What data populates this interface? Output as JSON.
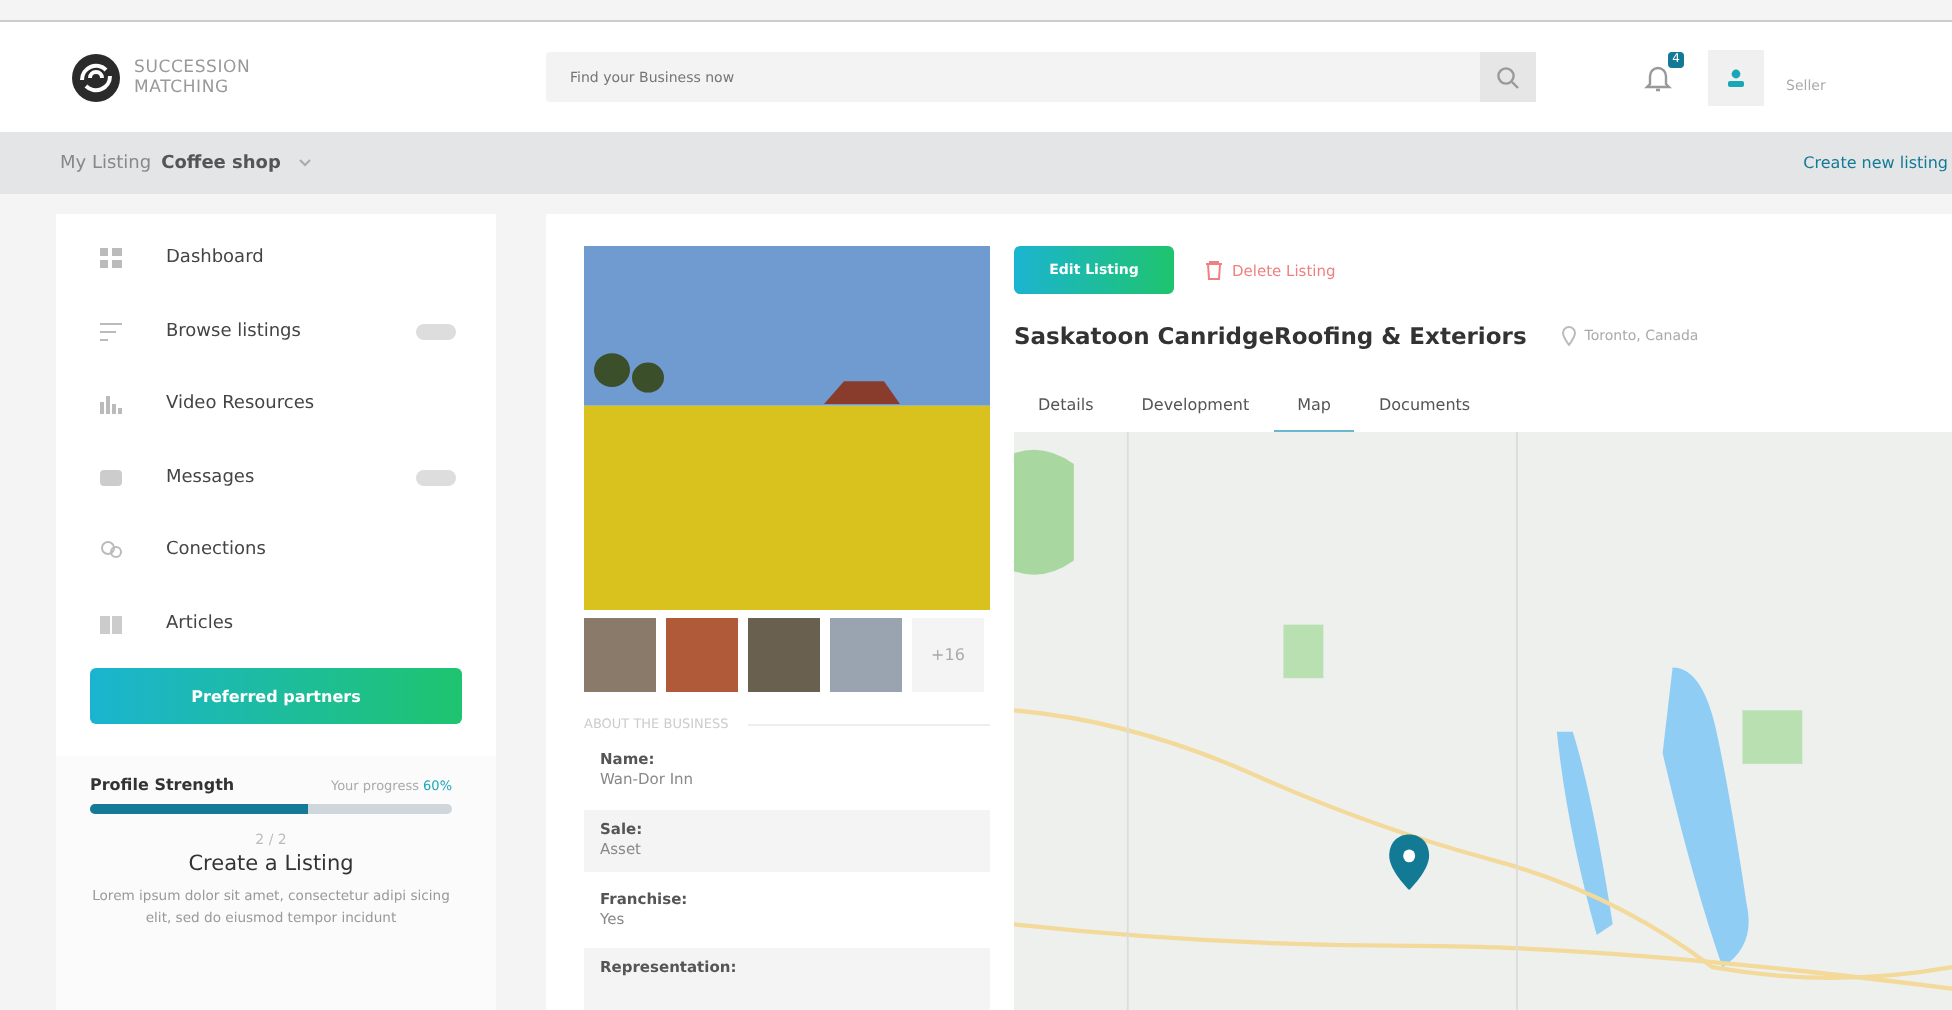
{
  "brand": {
    "line1": "SUCCESSION",
    "line2": "MATCHING"
  },
  "search": {
    "placeholder": "Find your Business now"
  },
  "notifications": {
    "count": "4"
  },
  "user": {
    "role": "Seller"
  },
  "subheader": {
    "label": "My Listing",
    "value": "Coffee shop",
    "action": "Create new listing"
  },
  "sidebar": {
    "items": [
      {
        "label": "Dashboard",
        "badge": false
      },
      {
        "label": "Browse listings",
        "badge": true
      },
      {
        "label": "Video Resources",
        "badge": false
      },
      {
        "label": "Messages",
        "badge": true
      },
      {
        "label": "Conections",
        "badge": false
      },
      {
        "label": "Articles",
        "badge": false
      }
    ],
    "button": "Preferred partners"
  },
  "profile": {
    "title": "Profile Strength",
    "progress_label": "Your progress",
    "progress_value": "60%",
    "level": 0.6,
    "step": "2 / 2",
    "heading": "Create a Listing",
    "text": "Lorem ipsum dolor sit amet, consectetur adipi sicing elit, sed do eiusmod tempor incidunt"
  },
  "gallery": {
    "more": "+16"
  },
  "about": {
    "heading": "ABOUT THE BUSINESS",
    "rows": [
      {
        "label": "Name:",
        "value": "Wan-Dor Inn"
      },
      {
        "label": "Sale:",
        "value": "Asset"
      },
      {
        "label": "Franchise:",
        "value": "Yes"
      },
      {
        "label": "Representation:"
      }
    ]
  },
  "listing": {
    "edit": "Edit Listing",
    "delete": "Delete Listing",
    "title": "Saskatoon CanridgeRoofing & Exteriors",
    "location": "Toronto, Canada"
  },
  "tabs": [
    {
      "label": "Details",
      "selected": false
    },
    {
      "label": "Development",
      "selected": false
    },
    {
      "label": "Map",
      "selected": true
    },
    {
      "label": "Documents",
      "selected": false
    }
  ]
}
